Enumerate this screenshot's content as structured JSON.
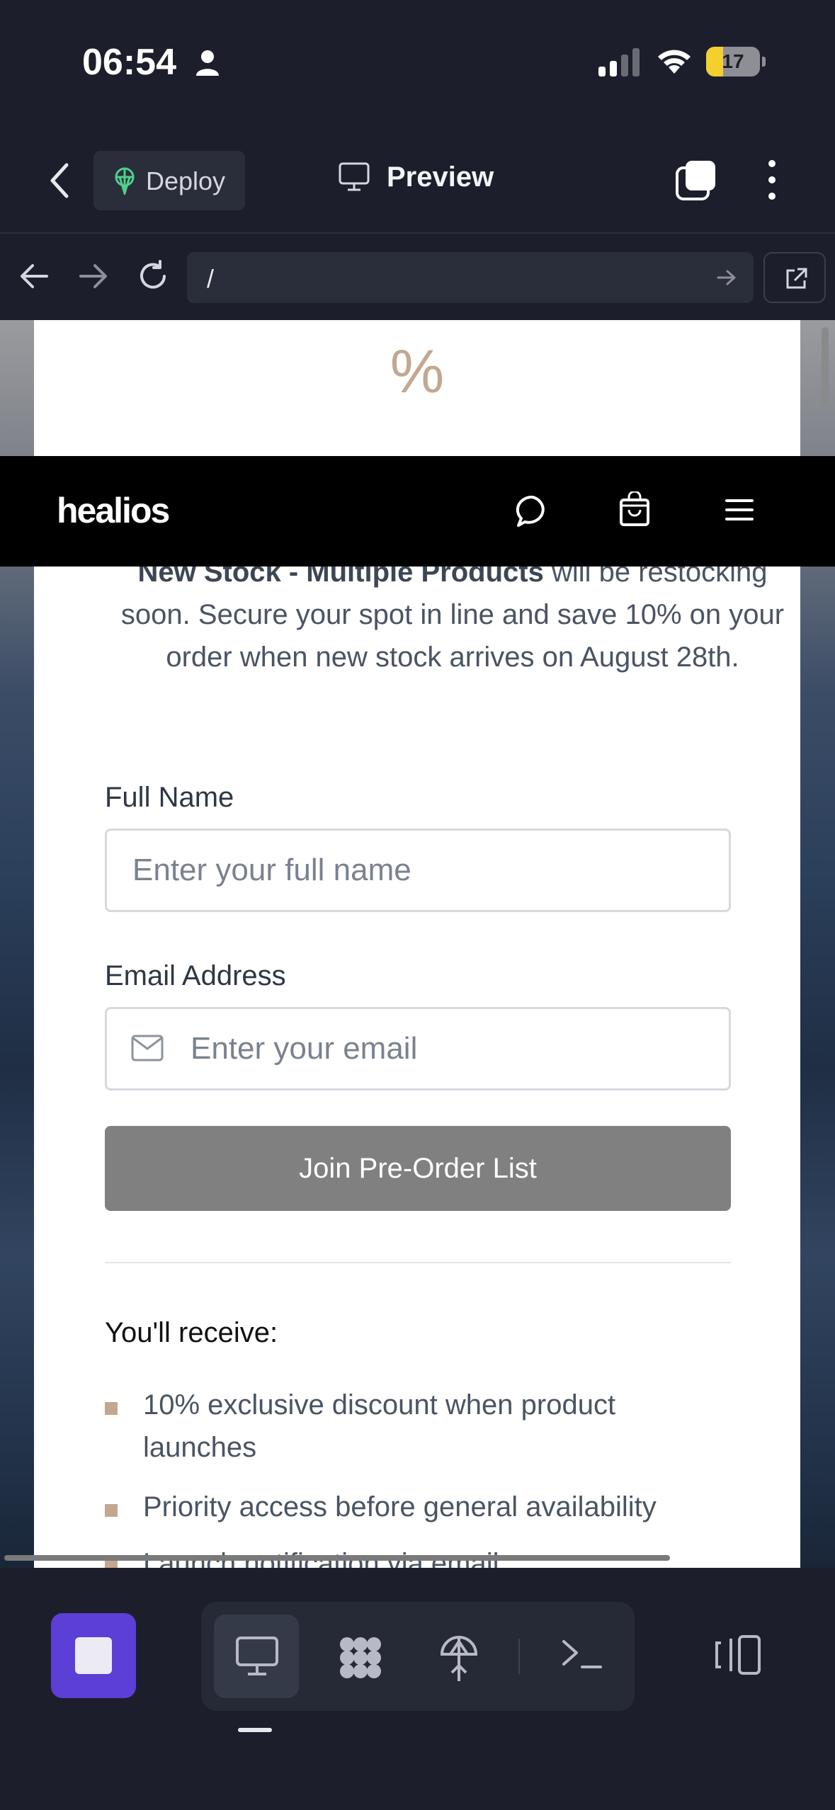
{
  "status_bar": {
    "time": "06:54",
    "battery_level": "17"
  },
  "app_header": {
    "deploy_label": "Deploy",
    "preview_label": "Preview"
  },
  "url_bar": {
    "url": "/"
  },
  "site": {
    "percent_icon": "%",
    "logo": "healios",
    "intro_bold": "New Stock - Multiple Products",
    "intro_rest": " will be restocking soon. Secure your spot in line and save 10% on your order when new stock arrives on August 28th.",
    "form": {
      "name_label": "Full Name",
      "name_placeholder": "Enter your full name",
      "email_label": "Email Address",
      "email_placeholder": "Enter your email",
      "submit_label": "Join Pre-Order List"
    },
    "receive_title": "You'll receive:",
    "benefits": [
      "10% exclusive discount when product launches",
      "Priority access before general availability",
      "Launch notification via email"
    ]
  },
  "colors": {
    "accent": "#c2a88f",
    "stop_button": "#5b3fd6",
    "submit_disabled": "#808080"
  }
}
